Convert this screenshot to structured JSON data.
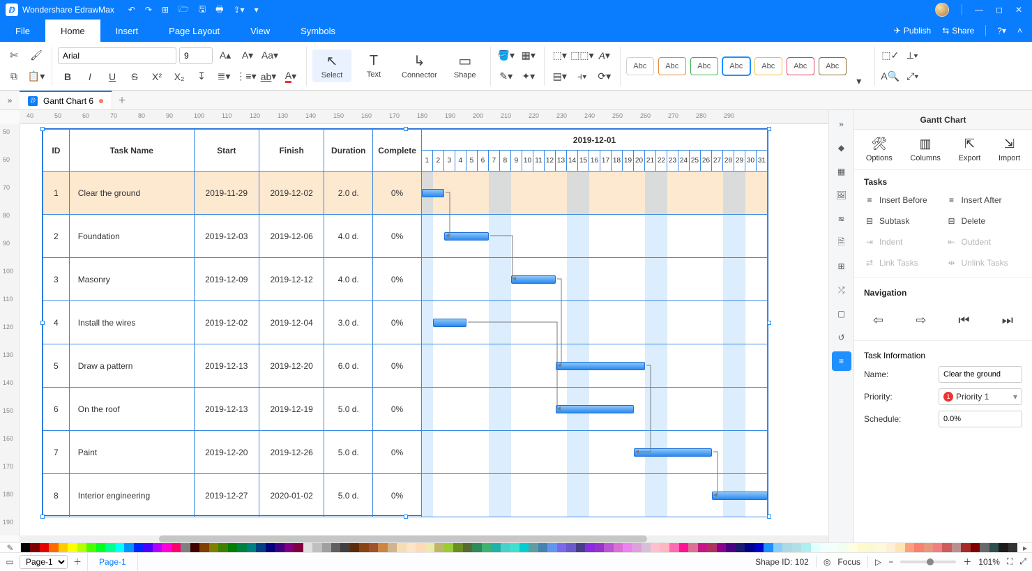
{
  "app": {
    "title": "Wondershare EdrawMax"
  },
  "menubar": {
    "tabs": [
      "File",
      "Home",
      "Insert",
      "Page Layout",
      "View",
      "Symbols"
    ],
    "active": 1,
    "publish": "Publish",
    "share": "Share"
  },
  "ribbon": {
    "font_name": "Arial",
    "font_size": "9",
    "tools": {
      "select": "Select",
      "text": "Text",
      "connector": "Connector",
      "shape": "Shape"
    },
    "swatch_label": "Abc",
    "swatch_selected": 3
  },
  "doc_tabs": {
    "current": "Gantt Chart 6"
  },
  "ruler_h": [
    40,
    50,
    60,
    70,
    80,
    90,
    100,
    110,
    120,
    130,
    140,
    150,
    160,
    170,
    180,
    190,
    200,
    210,
    220,
    230,
    240,
    250,
    260,
    270,
    280,
    290
  ],
  "ruler_v": [
    50,
    60,
    70,
    80,
    90,
    100,
    110,
    120,
    130,
    140,
    150,
    160,
    170,
    180,
    190
  ],
  "gantt": {
    "headers": {
      "id": "ID",
      "task": "Task Name",
      "start": "Start",
      "finish": "Finish",
      "duration": "Duration",
      "complete": "Complete",
      "month": "2019-12-01"
    },
    "days": 31,
    "weekends": [
      [
        1,
        1
      ],
      [
        7,
        8
      ],
      [
        14,
        15
      ],
      [
        21,
        22
      ],
      [
        28,
        29
      ]
    ],
    "rows": [
      {
        "id": "1",
        "name": "Clear the ground",
        "start": "2019-11-29",
        "finish": "2019-12-02",
        "duration": "2.0 d.",
        "pct": "0%",
        "bar_from": 0,
        "bar_to": 2,
        "link_to_row": 1,
        "link_to_day": 3
      },
      {
        "id": "2",
        "name": "Foundation",
        "start": "2019-12-03",
        "finish": "2019-12-06",
        "duration": "4.0 d.",
        "pct": "0%",
        "bar_from": 3,
        "bar_to": 6,
        "link_to_row": 2,
        "link_to_day": 9
      },
      {
        "id": "3",
        "name": "Masonry",
        "start": "2019-12-09",
        "finish": "2019-12-12",
        "duration": "4.0 d.",
        "pct": "0%",
        "bar_from": 9,
        "bar_to": 12,
        "link_to_row": 4,
        "link_to_day": 13
      },
      {
        "id": "4",
        "name": "Install the wires",
        "start": "2019-12-02",
        "finish": "2019-12-04",
        "duration": "3.0 d.",
        "pct": "0%",
        "bar_from": 2,
        "bar_to": 4,
        "link_to_row": 5,
        "link_to_day": 13
      },
      {
        "id": "5",
        "name": "Draw a pattern",
        "start": "2019-12-13",
        "finish": "2019-12-20",
        "duration": "6.0 d.",
        "pct": "0%",
        "bar_from": 13,
        "bar_to": 20,
        "link_to_row": 6,
        "link_to_day": 20
      },
      {
        "id": "6",
        "name": "On the roof",
        "start": "2019-12-13",
        "finish": "2019-12-19",
        "duration": "5.0 d.",
        "pct": "0%",
        "bar_from": 13,
        "bar_to": 19
      },
      {
        "id": "7",
        "name": "Paint",
        "start": "2019-12-20",
        "finish": "2019-12-26",
        "duration": "5.0 d.",
        "pct": "0%",
        "bar_from": 20,
        "bar_to": 26,
        "link_to_row": 7,
        "link_to_day": 27
      },
      {
        "id": "8",
        "name": "Interior engineering",
        "start": "2019-12-27",
        "finish": "2020-01-02",
        "duration": "5.0 d.",
        "pct": "0%",
        "bar_from": 27,
        "bar_to": 31
      }
    ],
    "selected": 0
  },
  "panel": {
    "title": "Gantt Chart",
    "top": {
      "options": "Options",
      "columns": "Columns",
      "export": "Export",
      "import": "Import"
    },
    "tasks_title": "Tasks",
    "tasks": {
      "insert_before": "Insert Before",
      "insert_after": "Insert After",
      "subtask": "Subtask",
      "delete": "Delete",
      "indent": "Indent",
      "outdent": "Outdent",
      "link": "Link Tasks",
      "unlink": "Unlink Tasks"
    },
    "nav_title": "Navigation",
    "info_title": "Task Information",
    "info": {
      "name_label": "Name:",
      "name_value": "Clear the ground",
      "priority_label": "Priority:",
      "priority_value": "Priority 1",
      "schedule_label": "Schedule:",
      "schedule_value": "0.0%"
    }
  },
  "status": {
    "page_select": "Page-1",
    "page_tab": "Page-1",
    "shape_id": "Shape ID: 102",
    "focus": "Focus",
    "zoom": "101%"
  },
  "colors": [
    "#000000",
    "#7f0000",
    "#e50000",
    "#ff6a00",
    "#ffcc00",
    "#ffff00",
    "#b6ff00",
    "#4cff00",
    "#00ff21",
    "#00ff90",
    "#00ffff",
    "#0094ff",
    "#0026ff",
    "#4800ff",
    "#b200ff",
    "#ff00dc",
    "#ff006e",
    "#808080",
    "#400000",
    "#804000",
    "#808000",
    "#408000",
    "#008000",
    "#008040",
    "#008080",
    "#004080",
    "#000080",
    "#400080",
    "#800080",
    "#800040",
    "#e0e0e0",
    "#c0c0c0",
    "#a0a0a0",
    "#606060",
    "#404040",
    "#5b2d0d",
    "#8b4513",
    "#a0522d",
    "#cd853f",
    "#d2b48c",
    "#f5deb3",
    "#ffe4c4",
    "#ffdab9",
    "#eee8aa",
    "#bdb76b",
    "#9acd32",
    "#6b8e23",
    "#556b2f",
    "#2e8b57",
    "#3cb371",
    "#20b2aa",
    "#48d1cc",
    "#40e0d0",
    "#00ced1",
    "#5f9ea0",
    "#4682b4",
    "#6495ed",
    "#7b68ee",
    "#6a5acd",
    "#483d8b",
    "#8a2be2",
    "#9932cc",
    "#ba55d3",
    "#da70d6",
    "#ee82ee",
    "#dda0dd",
    "#d8bfd8",
    "#ffc0cb",
    "#ffb6c1",
    "#ff69b4",
    "#ff1493",
    "#db7093",
    "#c71585",
    "#b03060",
    "#8b008b",
    "#4b0082",
    "#191970",
    "#00008b",
    "#0000cd",
    "#1e90ff",
    "#87cefa",
    "#add8e6",
    "#b0e0e6",
    "#afeeee",
    "#e0ffff",
    "#f0ffff",
    "#f5fffa",
    "#f0fff0",
    "#ffffe0",
    "#fffacd",
    "#fafad2",
    "#fff8dc",
    "#ffefd5",
    "#ffe4b5",
    "#ffa07a",
    "#fa8072",
    "#e9967a",
    "#f08080",
    "#cd5c5c",
    "#bc8f8f",
    "#a52a2a",
    "#800000",
    "#696969",
    "#2f4f4f",
    "#1c1c1c",
    "#333333"
  ]
}
